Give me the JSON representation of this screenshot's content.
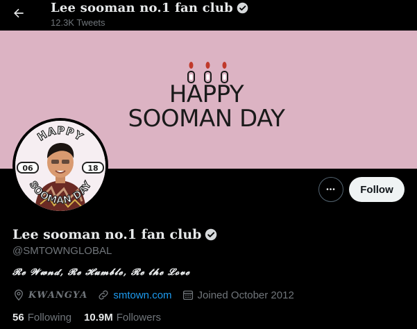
{
  "header": {
    "title": "Lee sooman no.1 fan club",
    "tweet_count": "12.3K Tweets"
  },
  "banner": {
    "line1": "HAPPY",
    "line2": "SOOMAN DAY"
  },
  "avatar": {
    "top_text": "HAPPY",
    "bottom_text": "SOOMAN DAY",
    "month": "06",
    "day": "18"
  },
  "actions": {
    "more_label": "•••",
    "follow_label": "Follow"
  },
  "profile": {
    "name": "Lee sooman no.1 fan club",
    "handle": "@SMTOWNGLOBAL",
    "bio": "𝓡𝓮 𝓦𝔀𝓷𝓭, 𝓡𝓮 𝓗𝓾𝓶𝓫𝓵𝓮, 𝓡𝓮 𝓽𝓱𝓮 𝓛𝓸𝓿𝓮",
    "location": "𝑲𝑾𝑨𝑵𝑮𝒀𝑨",
    "link": "smtown.com",
    "joined": "Joined October 2012"
  },
  "stats": {
    "following_count": "56",
    "following_label": "Following",
    "followers_count": "10.9M",
    "followers_label": "Followers"
  },
  "colors": {
    "background": "#000000",
    "banner": "#dcb3c3",
    "verified": "#d6d9db",
    "link": "#1d9bf0",
    "muted": "#71767b"
  },
  "icons": [
    "back-arrow-icon",
    "verified-badge-icon",
    "candle-icon",
    "more-icon",
    "location-icon",
    "link-icon",
    "calendar-icon"
  ]
}
